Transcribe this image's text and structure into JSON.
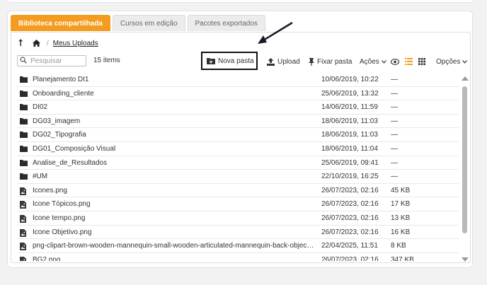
{
  "tabs": [
    "Biblioteca compartilhada",
    "Cursos em edição",
    "Pacotes exportados"
  ],
  "breadcrumb": {
    "current": "Meus Uploads"
  },
  "search": {
    "placeholder": "Pesquisar"
  },
  "count": "15 items",
  "toolbar": {
    "new_folder": "Nova pasta",
    "upload": "Upload",
    "pin": "Fixar pasta",
    "actions": "Ações",
    "options": "Opções"
  },
  "colors": {
    "accent": "#f39c1f",
    "list_icon_active": "#f39c1f"
  },
  "rows": [
    {
      "type": "folder",
      "name": "Planejamento DI1",
      "date": "10/06/2019, 10:22",
      "size": "—"
    },
    {
      "type": "folder",
      "name": "Onboarding_cliente",
      "date": "25/06/2019, 13:32",
      "size": "—"
    },
    {
      "type": "folder",
      "name": "DI02",
      "date": "14/06/2019, 11:59",
      "size": "—"
    },
    {
      "type": "folder",
      "name": "DG03_imagem",
      "date": "18/06/2019, 11:03",
      "size": "—"
    },
    {
      "type": "folder",
      "name": "DG02_Tipografia",
      "date": "18/06/2019, 11:03",
      "size": "—"
    },
    {
      "type": "folder",
      "name": "DG01_Composição Visual",
      "date": "18/06/2019, 11:04",
      "size": "—"
    },
    {
      "type": "folder",
      "name": "Analise_de_Resultados",
      "date": "25/06/2019, 09:41",
      "size": "—"
    },
    {
      "type": "folder",
      "name": "#UM",
      "date": "22/10/2019, 16:25",
      "size": "—"
    },
    {
      "type": "file",
      "name": "Icones.png",
      "date": "26/07/2023, 02:16",
      "size": "45 KB"
    },
    {
      "type": "file",
      "name": "Icone Tópicos.png",
      "date": "26/07/2023, 02:16",
      "size": "17 KB"
    },
    {
      "type": "file",
      "name": "Icone tempo.png",
      "date": "26/07/2023, 02:16",
      "size": "13 KB"
    },
    {
      "type": "file",
      "name": "Icone Objetivo.png",
      "date": "26/07/2023, 02:16",
      "size": "16 KB"
    },
    {
      "type": "file",
      "name": "png-clipart-brown-wooden-mannequin-small-wooden-articulated-mannequin-back-objects-mann...",
      "date": "22/04/2025, 11:51",
      "size": "8 KB"
    },
    {
      "type": "file",
      "name": "BG2.png",
      "date": "26/07/2023, 02:16",
      "size": "347 KB"
    }
  ]
}
